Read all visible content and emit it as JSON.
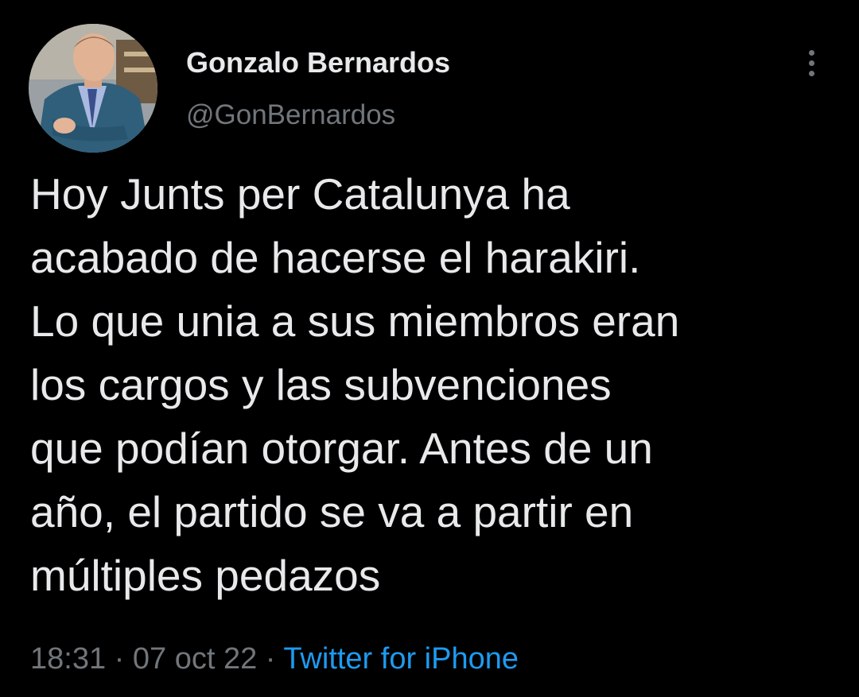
{
  "author": {
    "display_name": "Gonzalo Bernardos",
    "handle": "@GonBernardos"
  },
  "tweet": {
    "text_lines": [
      "Hoy Junts per Catalunya ha",
      "acabado de hacerse el harakiri.",
      "Lo que unia a sus miembros eran",
      "los cargos y las subvenciones",
      "que podían otorgar. Antes de un",
      "año, el partido se va a partir en",
      "múltiples pedazos"
    ],
    "time": "18:31",
    "separator": "·",
    "date": "07 oct 22",
    "source": "Twitter for iPhone"
  },
  "icons": {
    "more": "more-vertical-icon"
  },
  "colors": {
    "background": "#000000",
    "primary_text": "#e7e9ea",
    "secondary_text": "#71767b",
    "link": "#1d9bf0"
  }
}
